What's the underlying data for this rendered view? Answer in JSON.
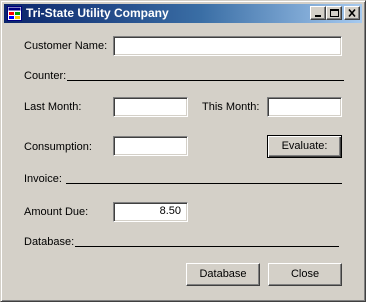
{
  "window": {
    "title": "Tri-State Utility Company",
    "controls": {
      "minimize": "minimize",
      "maximize": "maximize",
      "close": "close"
    }
  },
  "form": {
    "customer_name": {
      "label": "Customer Name:",
      "value": ""
    },
    "counter": {
      "label": "Counter:"
    },
    "last_month": {
      "label": "Last Month:",
      "value": ""
    },
    "this_month": {
      "label": "This Month:",
      "value": ""
    },
    "consumption": {
      "label": "Consumption:",
      "value": ""
    },
    "evaluate_button": "Evaluate:",
    "invoice": {
      "label": "Invoice:"
    },
    "amount_due": {
      "label": "Amount Due:",
      "value": "8.50"
    },
    "database": {
      "label": "Database:"
    },
    "database_button": "Database",
    "close_button": "Close"
  },
  "colors": {
    "face": "#d4d0c8",
    "title_start": "#0a246a",
    "title_end": "#a6caf0",
    "field_bg": "#ffffff"
  }
}
